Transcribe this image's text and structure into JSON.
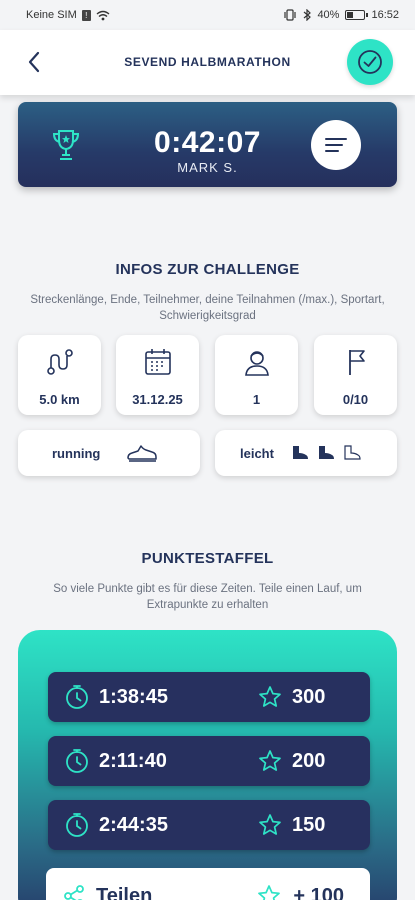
{
  "status_bar": {
    "carrier": "Keine SIM",
    "battery": "40%",
    "battery_level": 0.4,
    "time": "16:52"
  },
  "header": {
    "title": "SEVEND HALBMARATHON",
    "back_icon": "chevron-left-icon",
    "action_icon": "check-circle-icon"
  },
  "timer": {
    "value": "0:42:07",
    "name": "MARK S.",
    "icon": "trophy-icon",
    "menu_icon": "menu-lines-icon"
  },
  "info": {
    "title": "INFOS ZUR CHALLENGE",
    "subtitle": "Streckenlänge, Ende, Teilnehmer, deine Teilnahmen (/max.), Sportart, Schwierigkeitsgrad",
    "tiles": [
      {
        "icon": "route-icon",
        "value": "5.0 km"
      },
      {
        "icon": "calendar-icon",
        "value": "31.12.25"
      },
      {
        "icon": "participant-icon",
        "value": "1"
      },
      {
        "icon": "flag-icon",
        "value": "0/10"
      }
    ],
    "sport": {
      "label": "running",
      "icon": "running-shoe-icon"
    },
    "difficulty": {
      "label": "leicht",
      "icons": [
        "shoe-filled-icon",
        "shoe-filled-icon",
        "shoe-outline-icon"
      ],
      "level": 2,
      "max": 3
    }
  },
  "points": {
    "title": "PUNKTESTAFFEL",
    "subtitle": "So viele Punkte gibt es für diese Zeiten. Teile einen Lauf, um Extrapunkte zu erhalten",
    "tiers": [
      {
        "time": "1:38:45",
        "points": "300"
      },
      {
        "time": "2:11:40",
        "points": "200"
      },
      {
        "time": "2:44:35",
        "points": "150"
      }
    ],
    "share": {
      "label": "Teilen",
      "points": "+ 100",
      "icon": "share-icon"
    }
  },
  "colors": {
    "navy": "#24335b",
    "teal": "#2ee3c6",
    "row": "#27305f"
  }
}
